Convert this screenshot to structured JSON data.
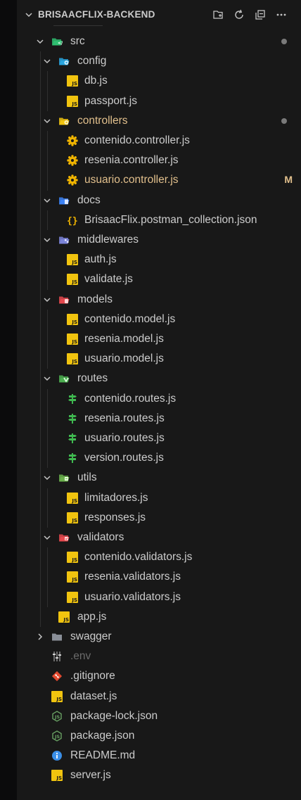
{
  "explorer": {
    "title": "BRISAACFLIX-BACKEND",
    "actions": [
      {
        "name": "new-file-button",
        "icon": "new-file-icon"
      },
      {
        "name": "refresh-explorer-button",
        "icon": "refresh-icon"
      },
      {
        "name": "collapse-folders-button",
        "icon": "collapse-all-icon"
      },
      {
        "name": "more-actions-button",
        "icon": "ellipsis-icon"
      }
    ]
  },
  "tree": [
    {
      "label": "src",
      "kind": "folder",
      "icon": "src-folder-icon",
      "color": "#2fbf71",
      "depth": 0,
      "open": true,
      "decoration": "dot"
    },
    {
      "label": "config",
      "kind": "folder",
      "icon": "config-folder-icon",
      "color": "#29a6e0",
      "depth": 1,
      "open": true
    },
    {
      "label": "db.js",
      "kind": "file",
      "icon": "js-file-icon",
      "depth": 2
    },
    {
      "label": "passport.js",
      "kind": "file",
      "icon": "js-file-icon",
      "depth": 2
    },
    {
      "label": "controllers",
      "kind": "folder",
      "icon": "controllers-folder-icon",
      "color": "#f1c40f",
      "depth": 1,
      "open": true,
      "text_color": "#e2c08d",
      "decoration": "dot"
    },
    {
      "label": "contenido.controller.js",
      "kind": "file",
      "icon": "gear-icon",
      "depth": 2
    },
    {
      "label": "resenia.controller.js",
      "kind": "file",
      "icon": "gear-icon",
      "depth": 2
    },
    {
      "label": "usuario.controller.js",
      "kind": "file",
      "icon": "gear-icon",
      "depth": 2,
      "text_color": "#e2c08d",
      "badge": "M"
    },
    {
      "label": "docs",
      "kind": "folder",
      "icon": "docs-folder-icon",
      "color": "#3b82f6",
      "depth": 1,
      "open": true
    },
    {
      "label": "BrisaacFlix.postman_collection.json",
      "kind": "file",
      "icon": "json-braces-icon",
      "depth": 2
    },
    {
      "label": "middlewares",
      "kind": "folder",
      "icon": "middlewares-folder-icon",
      "color": "#7b84d9",
      "depth": 1,
      "open": true
    },
    {
      "label": "auth.js",
      "kind": "file",
      "icon": "js-file-icon",
      "depth": 2
    },
    {
      "label": "validate.js",
      "kind": "file",
      "icon": "js-file-icon",
      "depth": 2
    },
    {
      "label": "models",
      "kind": "folder",
      "icon": "models-folder-icon",
      "color": "#e5484d",
      "depth": 1,
      "open": true
    },
    {
      "label": "contenido.model.js",
      "kind": "file",
      "icon": "js-file-icon",
      "depth": 2
    },
    {
      "label": "resenia.model.js",
      "kind": "file",
      "icon": "js-file-icon",
      "depth": 2
    },
    {
      "label": "usuario.model.js",
      "kind": "file",
      "icon": "js-file-icon",
      "depth": 2
    },
    {
      "label": "routes",
      "kind": "folder",
      "icon": "routes-folder-icon",
      "color": "#4caf50",
      "depth": 1,
      "open": true
    },
    {
      "label": "contenido.routes.js",
      "kind": "file",
      "icon": "route-signpost-icon",
      "depth": 2
    },
    {
      "label": "resenia.routes.js",
      "kind": "file",
      "icon": "route-signpost-icon",
      "depth": 2
    },
    {
      "label": "usuario.routes.js",
      "kind": "file",
      "icon": "route-signpost-icon",
      "depth": 2
    },
    {
      "label": "version.routes.js",
      "kind": "file",
      "icon": "route-signpost-icon",
      "depth": 2
    },
    {
      "label": "utils",
      "kind": "folder",
      "icon": "utils-folder-icon",
      "color": "#6ab04c",
      "depth": 1,
      "open": true
    },
    {
      "label": "limitadores.js",
      "kind": "file",
      "icon": "js-file-icon",
      "depth": 2
    },
    {
      "label": "responses.js",
      "kind": "file",
      "icon": "js-file-icon",
      "depth": 2
    },
    {
      "label": "validators",
      "kind": "folder",
      "icon": "validators-folder-icon",
      "color": "#e5484d",
      "depth": 1,
      "open": true
    },
    {
      "label": "contenido.validators.js",
      "kind": "file",
      "icon": "js-file-icon",
      "depth": 2
    },
    {
      "label": "resenia.validators.js",
      "kind": "file",
      "icon": "js-file-icon",
      "depth": 2
    },
    {
      "label": "usuario.validators.js",
      "kind": "file",
      "icon": "js-file-icon",
      "depth": 2
    },
    {
      "label": "app.js",
      "kind": "file",
      "icon": "js-file-icon",
      "depth": 1
    },
    {
      "label": "swagger",
      "kind": "folder",
      "icon": "folder-icon",
      "color": "#8a8f98",
      "depth": 0,
      "open": false
    },
    {
      "label": ".env",
      "kind": "file",
      "icon": "env-settings-icon",
      "depth": 0,
      "text_color": "#6b6b6b"
    },
    {
      "label": ".gitignore",
      "kind": "file",
      "icon": "git-icon",
      "depth": 0
    },
    {
      "label": "dataset.js",
      "kind": "file",
      "icon": "js-file-icon",
      "depth": 0
    },
    {
      "label": "package-lock.json",
      "kind": "file",
      "icon": "nodejs-icon",
      "depth": 0
    },
    {
      "label": "package.json",
      "kind": "file",
      "icon": "nodejs-icon",
      "depth": 0
    },
    {
      "label": "README.md",
      "kind": "file",
      "icon": "info-icon",
      "depth": 0
    },
    {
      "label": "server.js",
      "kind": "file",
      "icon": "js-file-icon",
      "depth": 0
    }
  ],
  "colors": {
    "modified_text": "#e2c08d",
    "js_yellow": "#f1c40f",
    "panel_bg": "#181818"
  }
}
